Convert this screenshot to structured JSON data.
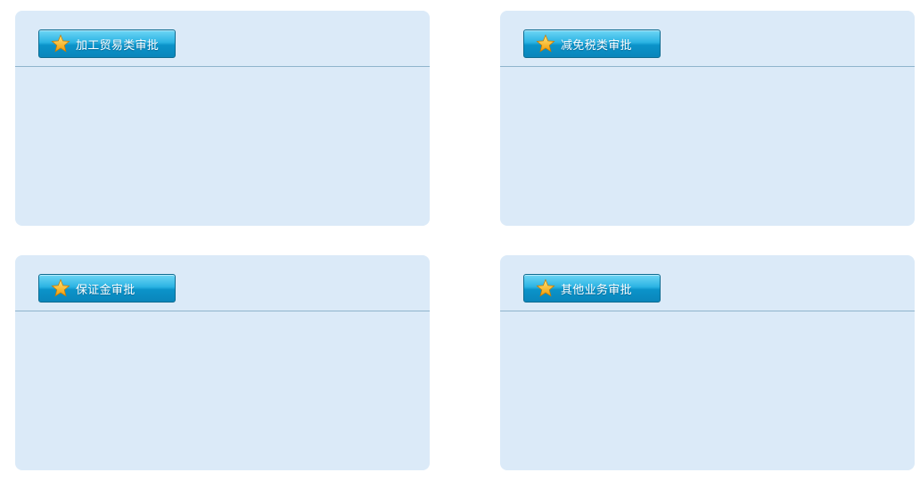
{
  "panels": [
    {
      "title": "加工贸易类审批",
      "icon": "star-icon"
    },
    {
      "title": "减免税类审批",
      "icon": "star-icon"
    },
    {
      "title": "保证金审批",
      "icon": "star-icon"
    },
    {
      "title": "其他业务审批",
      "icon": "star-icon"
    }
  ],
  "colors": {
    "panel_background": "#dbeaf8",
    "header_divider": "#8fb4cc",
    "button_top": "#6fd6f5",
    "button_bottom": "#0a86bb",
    "star": "#f7b20b",
    "title_text": "#ffffff"
  }
}
